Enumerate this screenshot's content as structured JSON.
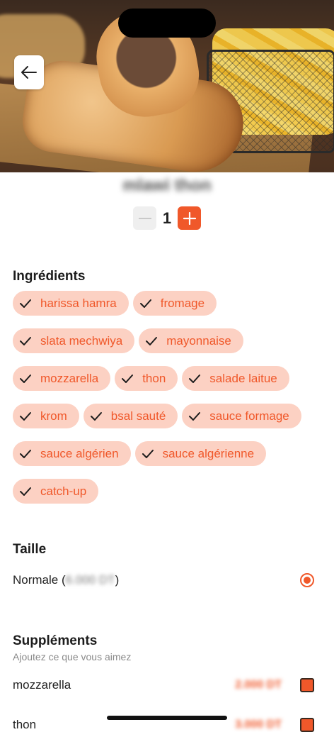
{
  "header": {
    "back_icon": "arrow-left-icon"
  },
  "dish": {
    "name": "mlawi thon",
    "quantity": "1"
  },
  "ingredients": {
    "title": "Ingrédients",
    "rows": [
      [
        "harissa hamra",
        "fromage"
      ],
      [
        "slata mechwiya",
        "mayonnaise"
      ],
      [
        "mozzarella",
        "thon",
        "salade laitue"
      ],
      [
        "krom",
        "bsal sauté",
        "sauce formage"
      ],
      [
        "sauce algérien",
        "sauce algérienne"
      ],
      [
        "catch-up"
      ]
    ]
  },
  "size": {
    "title": "Taille",
    "option_label": "Normale (",
    "option_price": "6.000 DT",
    "option_close": ")"
  },
  "supplements": {
    "title": "Suppléments",
    "subtitle": "Ajoutez ce que vous aimez",
    "items": [
      {
        "name": "mozzarella",
        "price": "2.000 DT"
      },
      {
        "name": "thon",
        "price": "3.000 DT"
      }
    ]
  },
  "colors": {
    "accent": "#f0582a",
    "chip_bg": "#fcd1c3"
  }
}
